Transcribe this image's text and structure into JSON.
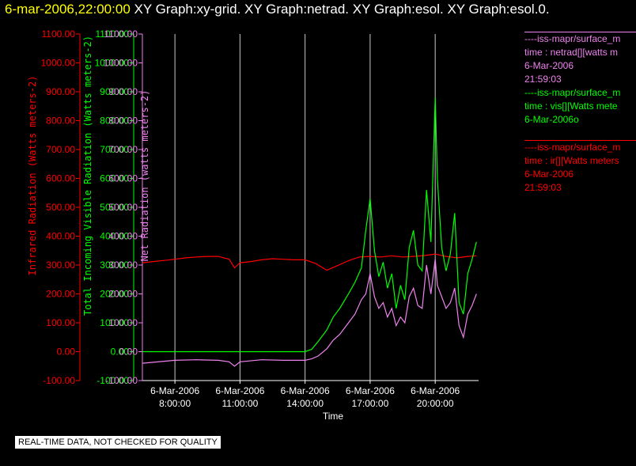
{
  "header": {
    "timestamp": "6-mar-2006,22:00:00",
    "graph_title": "XY Graph:xy-grid.  XY Graph:netrad.  XY Graph:esol.  XY Graph:esol.0."
  },
  "notice": "REAL-TIME DATA, NOT CHECKED FOR QUALITY",
  "colors": {
    "ir": "#ff0000",
    "vis": "#00ff00",
    "net": "#ee82ee",
    "grid": "#c8c8c8",
    "axis": "#ffffff",
    "background": "#000000"
  },
  "legend": [
    {
      "source": "----iss-mapr/surface_m",
      "desc": "time : netrad[][watts m",
      "date": "6-Mar-2006",
      "time": "21:59:03",
      "color": "#ee82ee"
    },
    {
      "source": "----iss-mapr/surface_m",
      "desc": "time : vis[][Watts mete",
      "date": "6-Mar-2006o",
      "time": "",
      "color": "#00ff00"
    },
    {
      "source": "----iss-mapr/surface_m",
      "desc": "time : ir[][Watts meters",
      "date": "6-Mar-2006",
      "time": "21:59:03",
      "color": "#ff0000"
    }
  ],
  "chart_data": {
    "type": "line",
    "xlabel": "Time",
    "x_unit": "hours on 6-Mar-2006",
    "xlim": [
      6.5,
      22.0
    ],
    "x_ticks": [
      {
        "value": 8,
        "line1": "6-Mar-2006",
        "line2": "8:00:00"
      },
      {
        "value": 11,
        "line1": "6-Mar-2006",
        "line2": "11:00:00"
      },
      {
        "value": 14,
        "line1": "6-Mar-2006",
        "line2": "14:00:00"
      },
      {
        "value": 17,
        "line1": "6-Mar-2006",
        "line2": "17:00:00"
      },
      {
        "value": 20,
        "line1": "6-Mar-2006",
        "line2": "20:00:00"
      }
    ],
    "grid": true,
    "axes": [
      {
        "id": "ir",
        "label": "Infrared Radiation (Watts meters-2)",
        "color": "#ff0000",
        "ylim": [
          -100,
          1100
        ],
        "ticks": [
          "1100.00",
          "1000.00",
          "900.00",
          "800.00",
          "700.00",
          "600.00",
          "500.00",
          "400.00",
          "300.00",
          "200.00",
          "100.00",
          "0.00",
          "-100.00"
        ]
      },
      {
        "id": "vis",
        "label": "Total Incoming Visible Radiation (Watts meters-2)",
        "color": "#00ff00",
        "ylim": [
          -100,
          1100
        ],
        "ticks": [
          "1100.00",
          "1000.00",
          "900.00",
          "800.00",
          "700.00",
          "600.00",
          "500.00",
          "400.00",
          "300.00",
          "200.00",
          "100.00",
          "0.00",
          "-100.00"
        ]
      },
      {
        "id": "net",
        "label": "Net Radiation (watts meters-2)",
        "color": "#ee82ee",
        "ylim": [
          -100,
          1100
        ],
        "ticks": [
          "1100.00",
          "1000.00",
          "900.00",
          "800.00",
          "700.00",
          "600.00",
          "500.00",
          "400.00",
          "300.00",
          "200.00",
          "100.00",
          "0.00",
          "-100.00"
        ]
      }
    ],
    "series": [
      {
        "name": "time : ir[][Watts meters",
        "axis": "ir",
        "color": "#ff0000",
        "x": [
          6.5,
          7.0,
          7.5,
          8.0,
          8.5,
          9.0,
          9.5,
          10.0,
          10.5,
          10.75,
          11.0,
          11.5,
          12.0,
          12.5,
          13.0,
          13.5,
          14.0,
          14.5,
          15.0,
          15.5,
          16.0,
          16.5,
          17.0,
          17.5,
          18.0,
          18.5,
          19.0,
          19.5,
          20.0,
          20.5,
          21.0,
          21.5,
          21.9
        ],
        "y": [
          308,
          312,
          316,
          320,
          325,
          328,
          330,
          330,
          320,
          290,
          308,
          312,
          318,
          322,
          320,
          318,
          318,
          305,
          282,
          298,
          315,
          328,
          330,
          328,
          332,
          328,
          330,
          333,
          338,
          330,
          325,
          330,
          332
        ]
      },
      {
        "name": "time : vis[][Watts mete",
        "axis": "vis",
        "color": "#00ff00",
        "x": [
          6.5,
          8.0,
          9.0,
          10.0,
          11.0,
          12.0,
          13.0,
          14.0,
          14.3,
          14.6,
          15.0,
          15.3,
          15.6,
          16.0,
          16.3,
          16.6,
          16.8,
          17.0,
          17.2,
          17.4,
          17.6,
          17.8,
          18.0,
          18.2,
          18.4,
          18.6,
          18.8,
          19.0,
          19.2,
          19.4,
          19.6,
          19.8,
          20.0,
          20.1,
          20.3,
          20.5,
          20.7,
          20.9,
          21.1,
          21.3,
          21.5,
          21.7,
          21.9
        ],
        "y": [
          0,
          0,
          0,
          0,
          0,
          0,
          0,
          0,
          8,
          35,
          75,
          120,
          150,
          200,
          240,
          290,
          420,
          530,
          350,
          260,
          310,
          220,
          270,
          150,
          230,
          180,
          360,
          420,
          300,
          280,
          560,
          380,
          880,
          600,
          360,
          280,
          340,
          480,
          170,
          130,
          270,
          320,
          380
        ]
      },
      {
        "name": "time : netrad[][watts m",
        "axis": "net",
        "color": "#ee82ee",
        "x": [
          6.5,
          8.0,
          9.0,
          10.0,
          10.5,
          10.75,
          11.0,
          12.0,
          13.0,
          14.0,
          14.3,
          14.6,
          15.0,
          15.3,
          15.6,
          16.0,
          16.3,
          16.6,
          16.8,
          17.0,
          17.2,
          17.4,
          17.6,
          17.8,
          18.0,
          18.2,
          18.4,
          18.6,
          18.8,
          19.0,
          19.2,
          19.4,
          19.6,
          19.8,
          20.0,
          20.1,
          20.3,
          20.5,
          20.7,
          20.9,
          21.1,
          21.3,
          21.5,
          21.7,
          21.9
        ],
        "y": [
          -40,
          -30,
          -28,
          -30,
          -35,
          -50,
          -35,
          -28,
          -30,
          -30,
          -25,
          -15,
          10,
          40,
          60,
          100,
          130,
          180,
          200,
          270,
          190,
          150,
          170,
          120,
          150,
          90,
          120,
          100,
          190,
          220,
          160,
          150,
          300,
          200,
          320,
          230,
          190,
          150,
          170,
          220,
          90,
          50,
          130,
          160,
          200
        ]
      }
    ]
  }
}
